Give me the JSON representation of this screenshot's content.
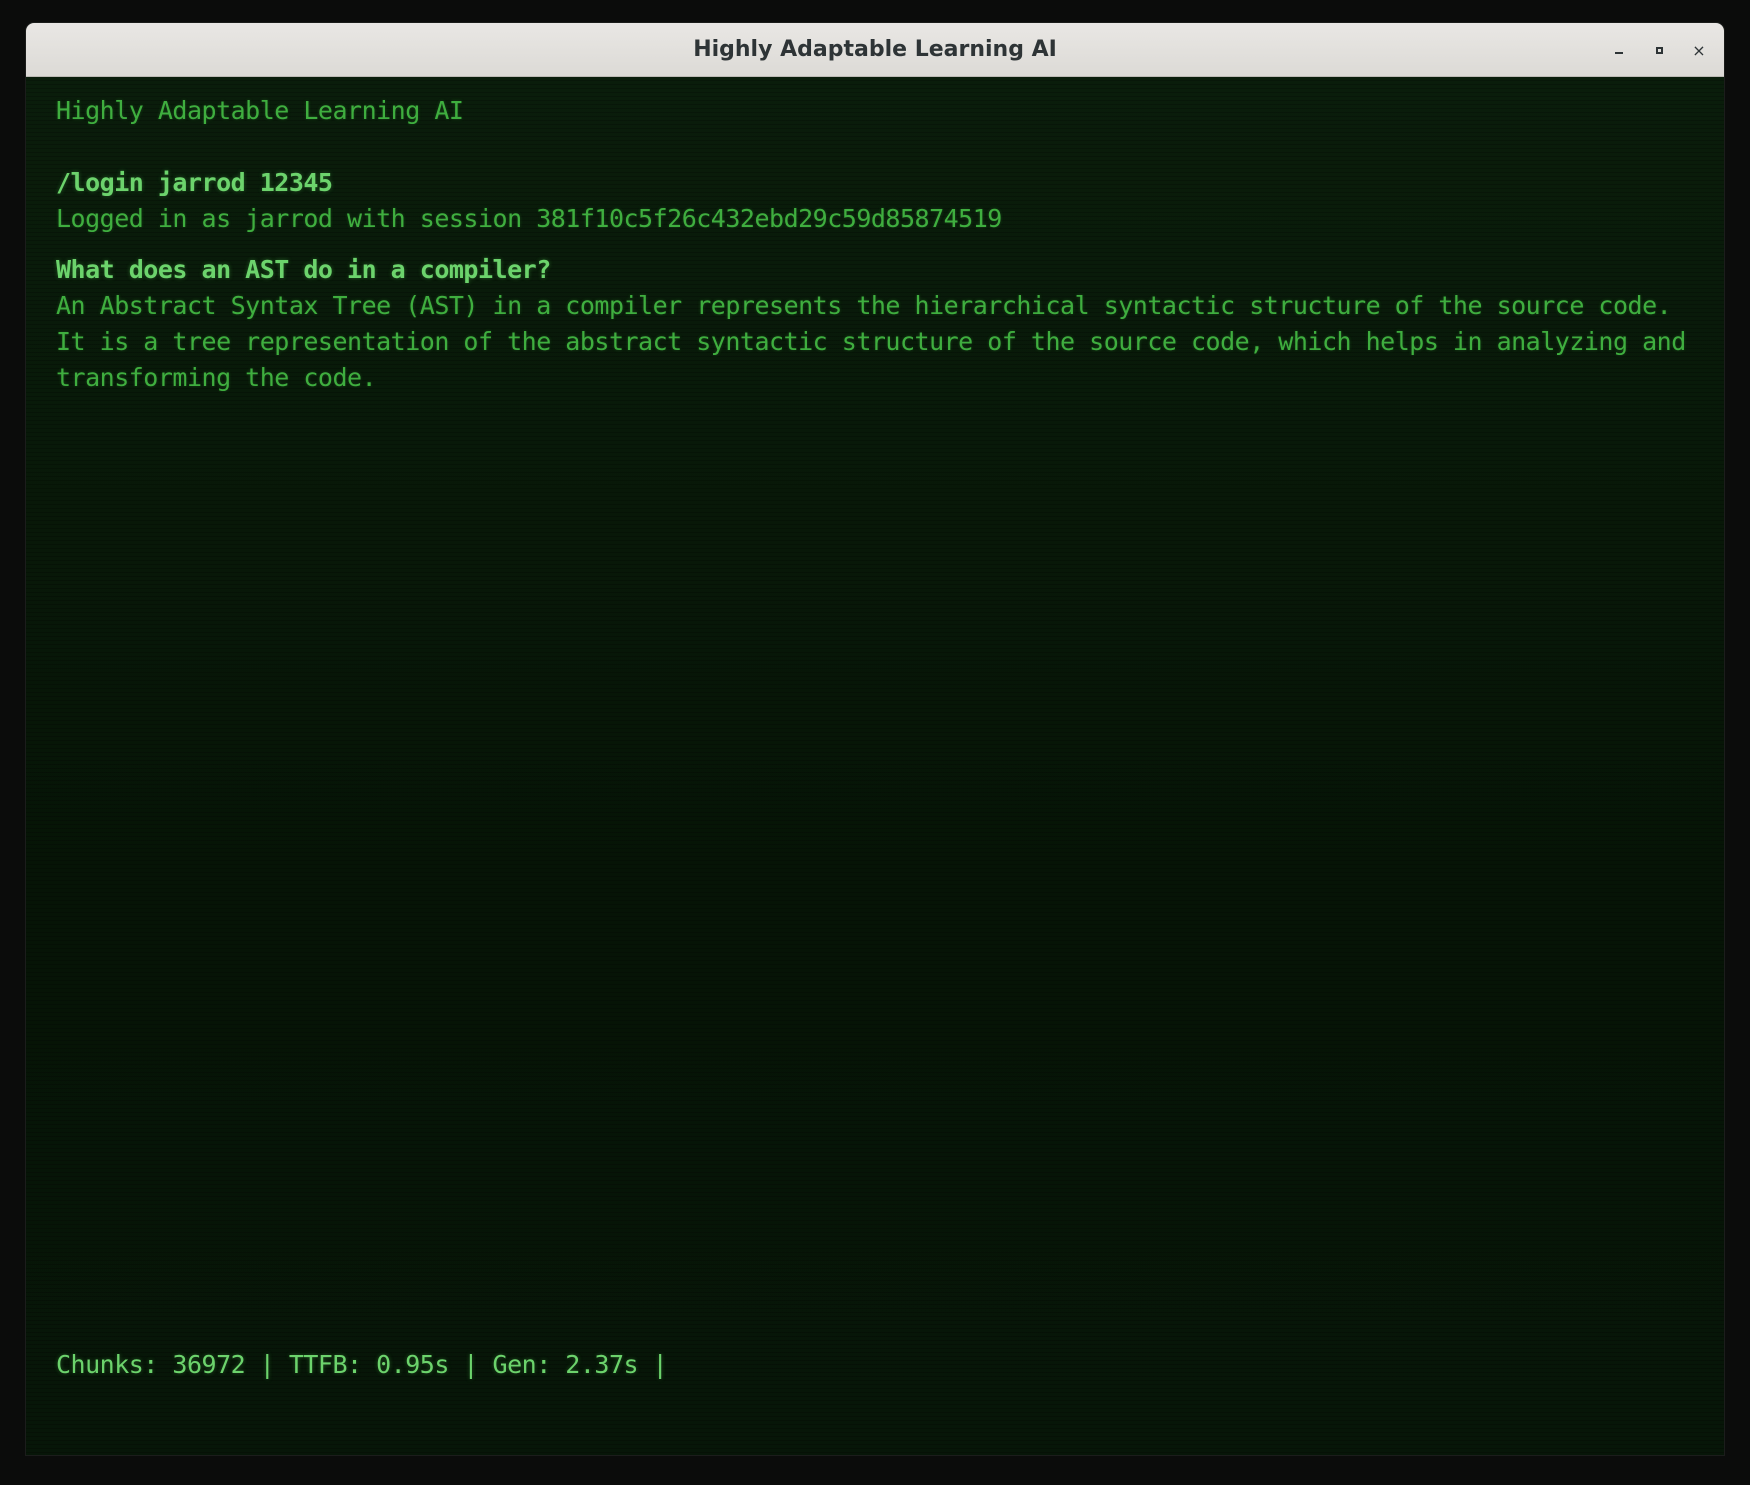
{
  "window": {
    "title": "Highly Adaptable Learning AI",
    "controls": {
      "minimize_label": "_",
      "maximize_label": "□",
      "close_label": "×"
    }
  },
  "terminal": {
    "banner": "Highly Adaptable Learning AI",
    "login_command": "/login jarrod 12345",
    "login_response": "Logged in as jarrod with session 381f10c5f26c432ebd29c59d85874519",
    "question": "What does an AST do in a compiler?",
    "answer_lines": [
      "An Abstract Syntax Tree (AST) in a compiler represents the hierarchical syntactic structure of the source code.",
      "It is a tree representation of the abstract syntactic structure of the source code, which helps in analyzing and",
      "transforming the code."
    ],
    "status_line": "Chunks: 36972 | TTFB: 0.95s | Gen: 2.37s |"
  },
  "colors": {
    "terminal_bg": "#081808",
    "text_bright": "#6cd36c",
    "text_normal": "#3fae3f",
    "titlebar_bg": "#e9e7e4"
  }
}
